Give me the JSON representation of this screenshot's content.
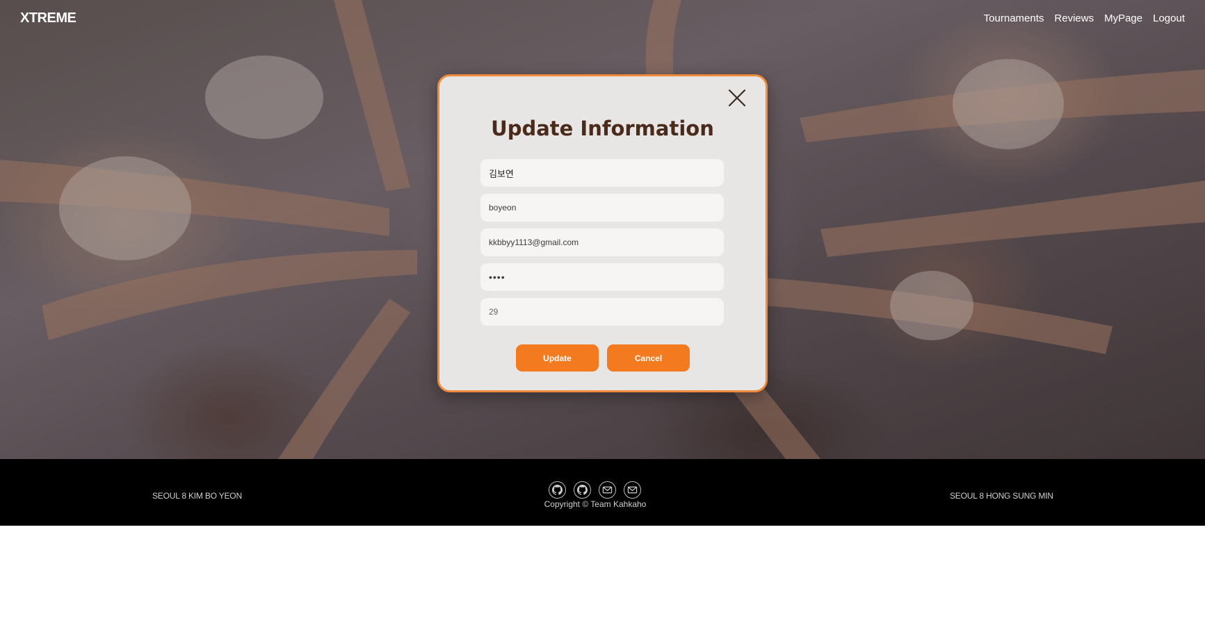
{
  "header": {
    "brand": "XTREME",
    "nav": [
      "Tournaments",
      "Reviews",
      "MyPage",
      "Logout"
    ]
  },
  "modal": {
    "title": "Update Information",
    "close_icon": "close-icon",
    "fields": {
      "name": "김보연",
      "username": "boyeon",
      "email": "kkbbyy1113@gmail.com",
      "password": "••••",
      "age": "29"
    },
    "buttons": {
      "update": "Update",
      "cancel": "Cancel"
    },
    "colors": {
      "accent": "#f47a1f",
      "border": "#f08a3c",
      "title": "#4a2a1a"
    }
  },
  "footer": {
    "left": "SEOUL 8 KIM BO YEON",
    "right": "SEOUL 8 HONG SUNG MIN",
    "icons": [
      "github-icon",
      "github-icon",
      "mail-icon",
      "mail-icon"
    ],
    "copyright": "Copyright © Team Kahkaho"
  }
}
